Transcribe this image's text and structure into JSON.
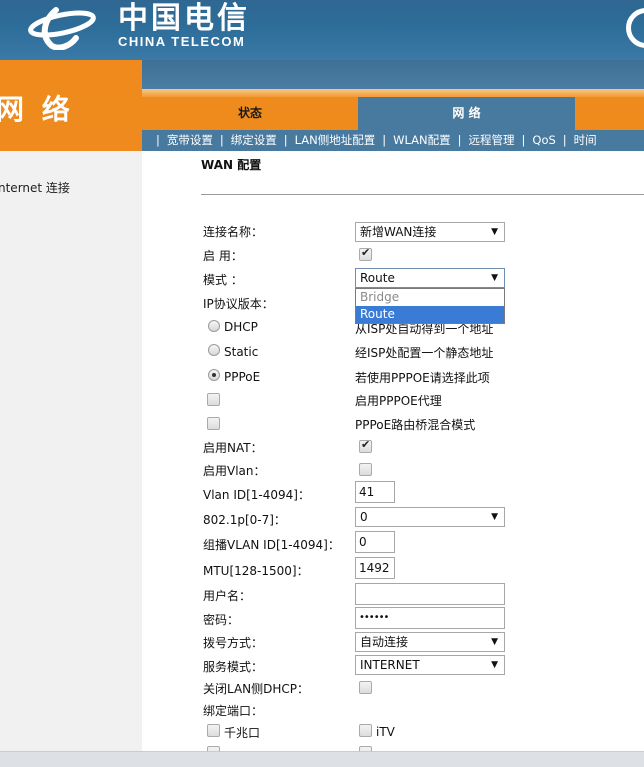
{
  "header": {
    "logo_cn": "中国电信",
    "logo_en": "CHINA TELECOM"
  },
  "left": {
    "title": "网 络",
    "sidebar_item": "nternet 连接"
  },
  "main_tabs": {
    "status": "状态",
    "network": "网 络"
  },
  "sub_tabs": [
    "宽带设置",
    "绑定设置",
    "LAN侧地址配置",
    "WLAN配置",
    "远程管理",
    "QoS",
    "时间"
  ],
  "content": {
    "title": "WAN 配置",
    "rows": {
      "conn_name": {
        "label": "连接名称：",
        "value": "新增WAN连接"
      },
      "enable": {
        "label": "启 用："
      },
      "mode": {
        "label": "模式 ：",
        "value": "Route",
        "options": [
          "Bridge",
          "Route"
        ]
      },
      "ip_version": {
        "label": "IP协议版本："
      },
      "dhcp": {
        "label": "DHCP",
        "desc": "从ISP处自动得到一个地址"
      },
      "static": {
        "label": "Static",
        "desc": "经ISP处配置一个静态地址"
      },
      "pppoe": {
        "label": "PPPoE",
        "desc": "若使用PPPOE请选择此项"
      },
      "pppoe_proxy": {
        "desc": "启用PPPOE代理"
      },
      "pppoe_bridge": {
        "desc": "PPPoE路由桥混合模式"
      },
      "nat": {
        "label": "启用NAT："
      },
      "vlan": {
        "label": "启用Vlan："
      },
      "vlan_id": {
        "label": "Vlan ID[1-4094]：",
        "value": "41"
      },
      "dot1p": {
        "label": "802.1p[0-7]：",
        "value": "0"
      },
      "mcast_vlan": {
        "label": "组播VLAN ID[1-4094]：",
        "value": "0"
      },
      "mtu": {
        "label": "MTU[128-1500]：",
        "value": "1492"
      },
      "username": {
        "label": "用户名：",
        "value": ""
      },
      "password": {
        "label": "密码：",
        "value": "••••••"
      },
      "dial_mode": {
        "label": "拨号方式：",
        "value": "自动连接"
      },
      "service_mode": {
        "label": "服务模式：",
        "value": "INTERNET"
      },
      "close_lan_dhcp": {
        "label": "关闭LAN侧DHCP："
      },
      "bind_port": {
        "label": "绑定端口："
      },
      "port_gigabit": {
        "label": "千兆口"
      },
      "port_itv": {
        "label": "iTV"
      }
    }
  },
  "colors": {
    "header_blue": "#2d6d99",
    "orange": "#ef8a1d",
    "tab_blue": "#48799f",
    "dropdown_highlight": "#3a7bd5"
  }
}
